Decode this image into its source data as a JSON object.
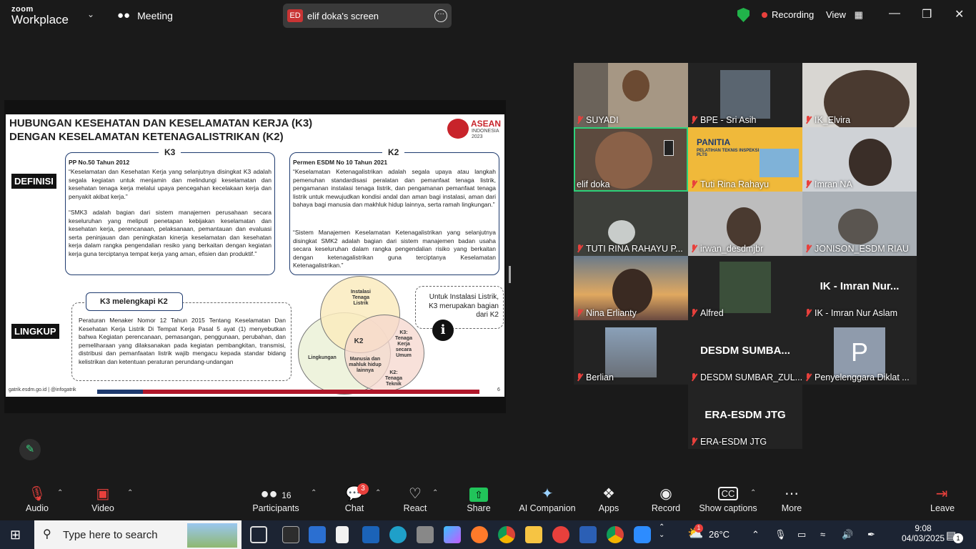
{
  "titlebar": {
    "brand_top": "zoom",
    "brand_bottom": "Workplace",
    "meeting_label": "Meeting",
    "share_initials": "ED",
    "share_label": "elif doka's screen",
    "recording_label": "Recording",
    "view_label": "View"
  },
  "slide": {
    "title": "HUBUNGAN KESEHATAN DAN KESELAMATAN KERJA (K3) DENGAN KESELAMATAN KETENAGALISTRIKAN (K2)",
    "logo_word": "ASEAN",
    "logo_sub": "INDONESIA 2023",
    "tag_definisi": "DEFINISI",
    "tag_lingkup": "LINGKUP",
    "k3": {
      "head": "K3",
      "source": "PP No.50 Tahun 2012",
      "def1": "“Keselamatan dan Kesehatan Kerja yang selanjutnya disingkat K3 adalah segala kegiatan untuk menjamin dan melindungi keselamatan dan kesehatan tenaga kerja melalui upaya pencegahan kecelakaan kerja dan penyakit akibat kerja.”",
      "def2": "“SMK3 adalah bagian dari sistem manajemen perusahaan secara keseluruhan yang meliputi penetapan kebijakan keselamatan dan kesehatan kerja, perencanaan, pelaksanaan, pemantauan dan evaluasi serta peninjauan dan peningkatan kinerja keselamatan dan kesehatan kerja dalam rangka pengendalian resiko yang berkaitan dengan kegiatan kerja guna terciptanya tempat kerja yang aman, efisien dan produktif.”"
    },
    "k2": {
      "head": "K2",
      "source": "Permen ESDM No 10 Tahun 2021",
      "def1": "“Keselamatan Ketenagalistrikan adalah segala upaya atau langkah pemenuhan standardisasi peralatan dan pemanfaat tenaga listrik, pengamanan instalasi tenaga listrik, dan pengamanan pemanfaat tenaga listrik untuk mewujudkan kondisi andal dan aman bagi instalasi, aman dari bahaya bagi manusia dan makhluk hidup lainnya, serta ramah lingkungan.”",
      "def2": "“Sistem Manajemen Keselamatan Ketenagalistrikan yang selanjutnya disingkat SMK2 adalah bagian dari sistem manajemen badan usaha secara keseluruhan dalam rangka pengendalian risiko yang berkaitan dengan ketenagalistrikan guna terciptanya Keselamatan Ketenagalistrikan.”"
    },
    "lingkup_head": "K3 melengkapi K2",
    "lingkup_text": "Peraturan Menaker Nomor 12 Tahun 2015 Tentang Keselamatan Dan Kesehatan Kerja Listrik Di Tempat Kerja Pasal 5 ayat (1) menyebutkan bahwa Kegiatan perencanaan, pemasangan, penggunaan, perubahan, dan pemeliharaan yang dilaksanakan pada kegiatan pembangkitan, transmisi, distribusi dan pemanfaatan listrik wajib mengacu kepada standar bidang kelistrikan dan ketentuan peraturan perundang-undangan",
    "venn": {
      "top": "Instalasi Tenaga Listrik",
      "left": "Lingkungan",
      "center": "K2",
      "inner": "Manusia dan mahluk hidup lainnya",
      "k3": "K3: Tenaga Kerja secara Umum",
      "k2": "K2: Tenaga Teknik"
    },
    "note": "Untuk Instalasi Listrik, K3 merupakan bagian dari K2",
    "footer": "gatrik.esdm.go.id | @infogatrik",
    "page": "6"
  },
  "participants": [
    {
      "name": "SUYADI"
    },
    {
      "name": "BPE - Sri Asih"
    },
    {
      "name": "IK_Elvira"
    },
    {
      "name": "elif doka"
    },
    {
      "name": "Tuti Rina Rahayu",
      "banner_title": "PANITIA",
      "banner_sub": "PELATIHAN TEKNIS INSPEKSI PLTS"
    },
    {
      "name": "Imran NA"
    },
    {
      "name": "TUTI RINA RAHAYU P..."
    },
    {
      "name": "irwan_desdmjbr"
    },
    {
      "name": "JONISON_ESDM RIAU"
    },
    {
      "name": "Nina Erlianty"
    },
    {
      "name": "Alfred"
    },
    {
      "name": "IK - Imran Nur Aslam",
      "display": "IK - Imran Nur..."
    },
    {
      "name": "Berlian"
    },
    {
      "name": "DESDM SUMBAR_ZUL...",
      "display": "DESDM SUMBA..."
    },
    {
      "name": "Penyelenggara Diklat ...",
      "initial": "P"
    },
    {
      "name": "ERA-ESDM JTG",
      "display": "ERA-ESDM JTG"
    }
  ],
  "toolbar": {
    "audio": "Audio",
    "video": "Video",
    "participants": "Participants",
    "participants_count": "16",
    "chat": "Chat",
    "chat_badge": "3",
    "react": "React",
    "share": "Share",
    "ai": "AI Companion",
    "apps": "Apps",
    "record": "Record",
    "captions": "Show captions",
    "more": "More",
    "leave": "Leave"
  },
  "taskbar": {
    "search_placeholder": "Type here to search",
    "weather": "26°C",
    "weather_badge": "1",
    "time": "9:08",
    "date": "04/03/2025",
    "notif_count": "1"
  },
  "colors": {
    "active_speaker": "#2dd17a",
    "recording_dot": "#e8403c",
    "share_green": "#21c45a"
  }
}
